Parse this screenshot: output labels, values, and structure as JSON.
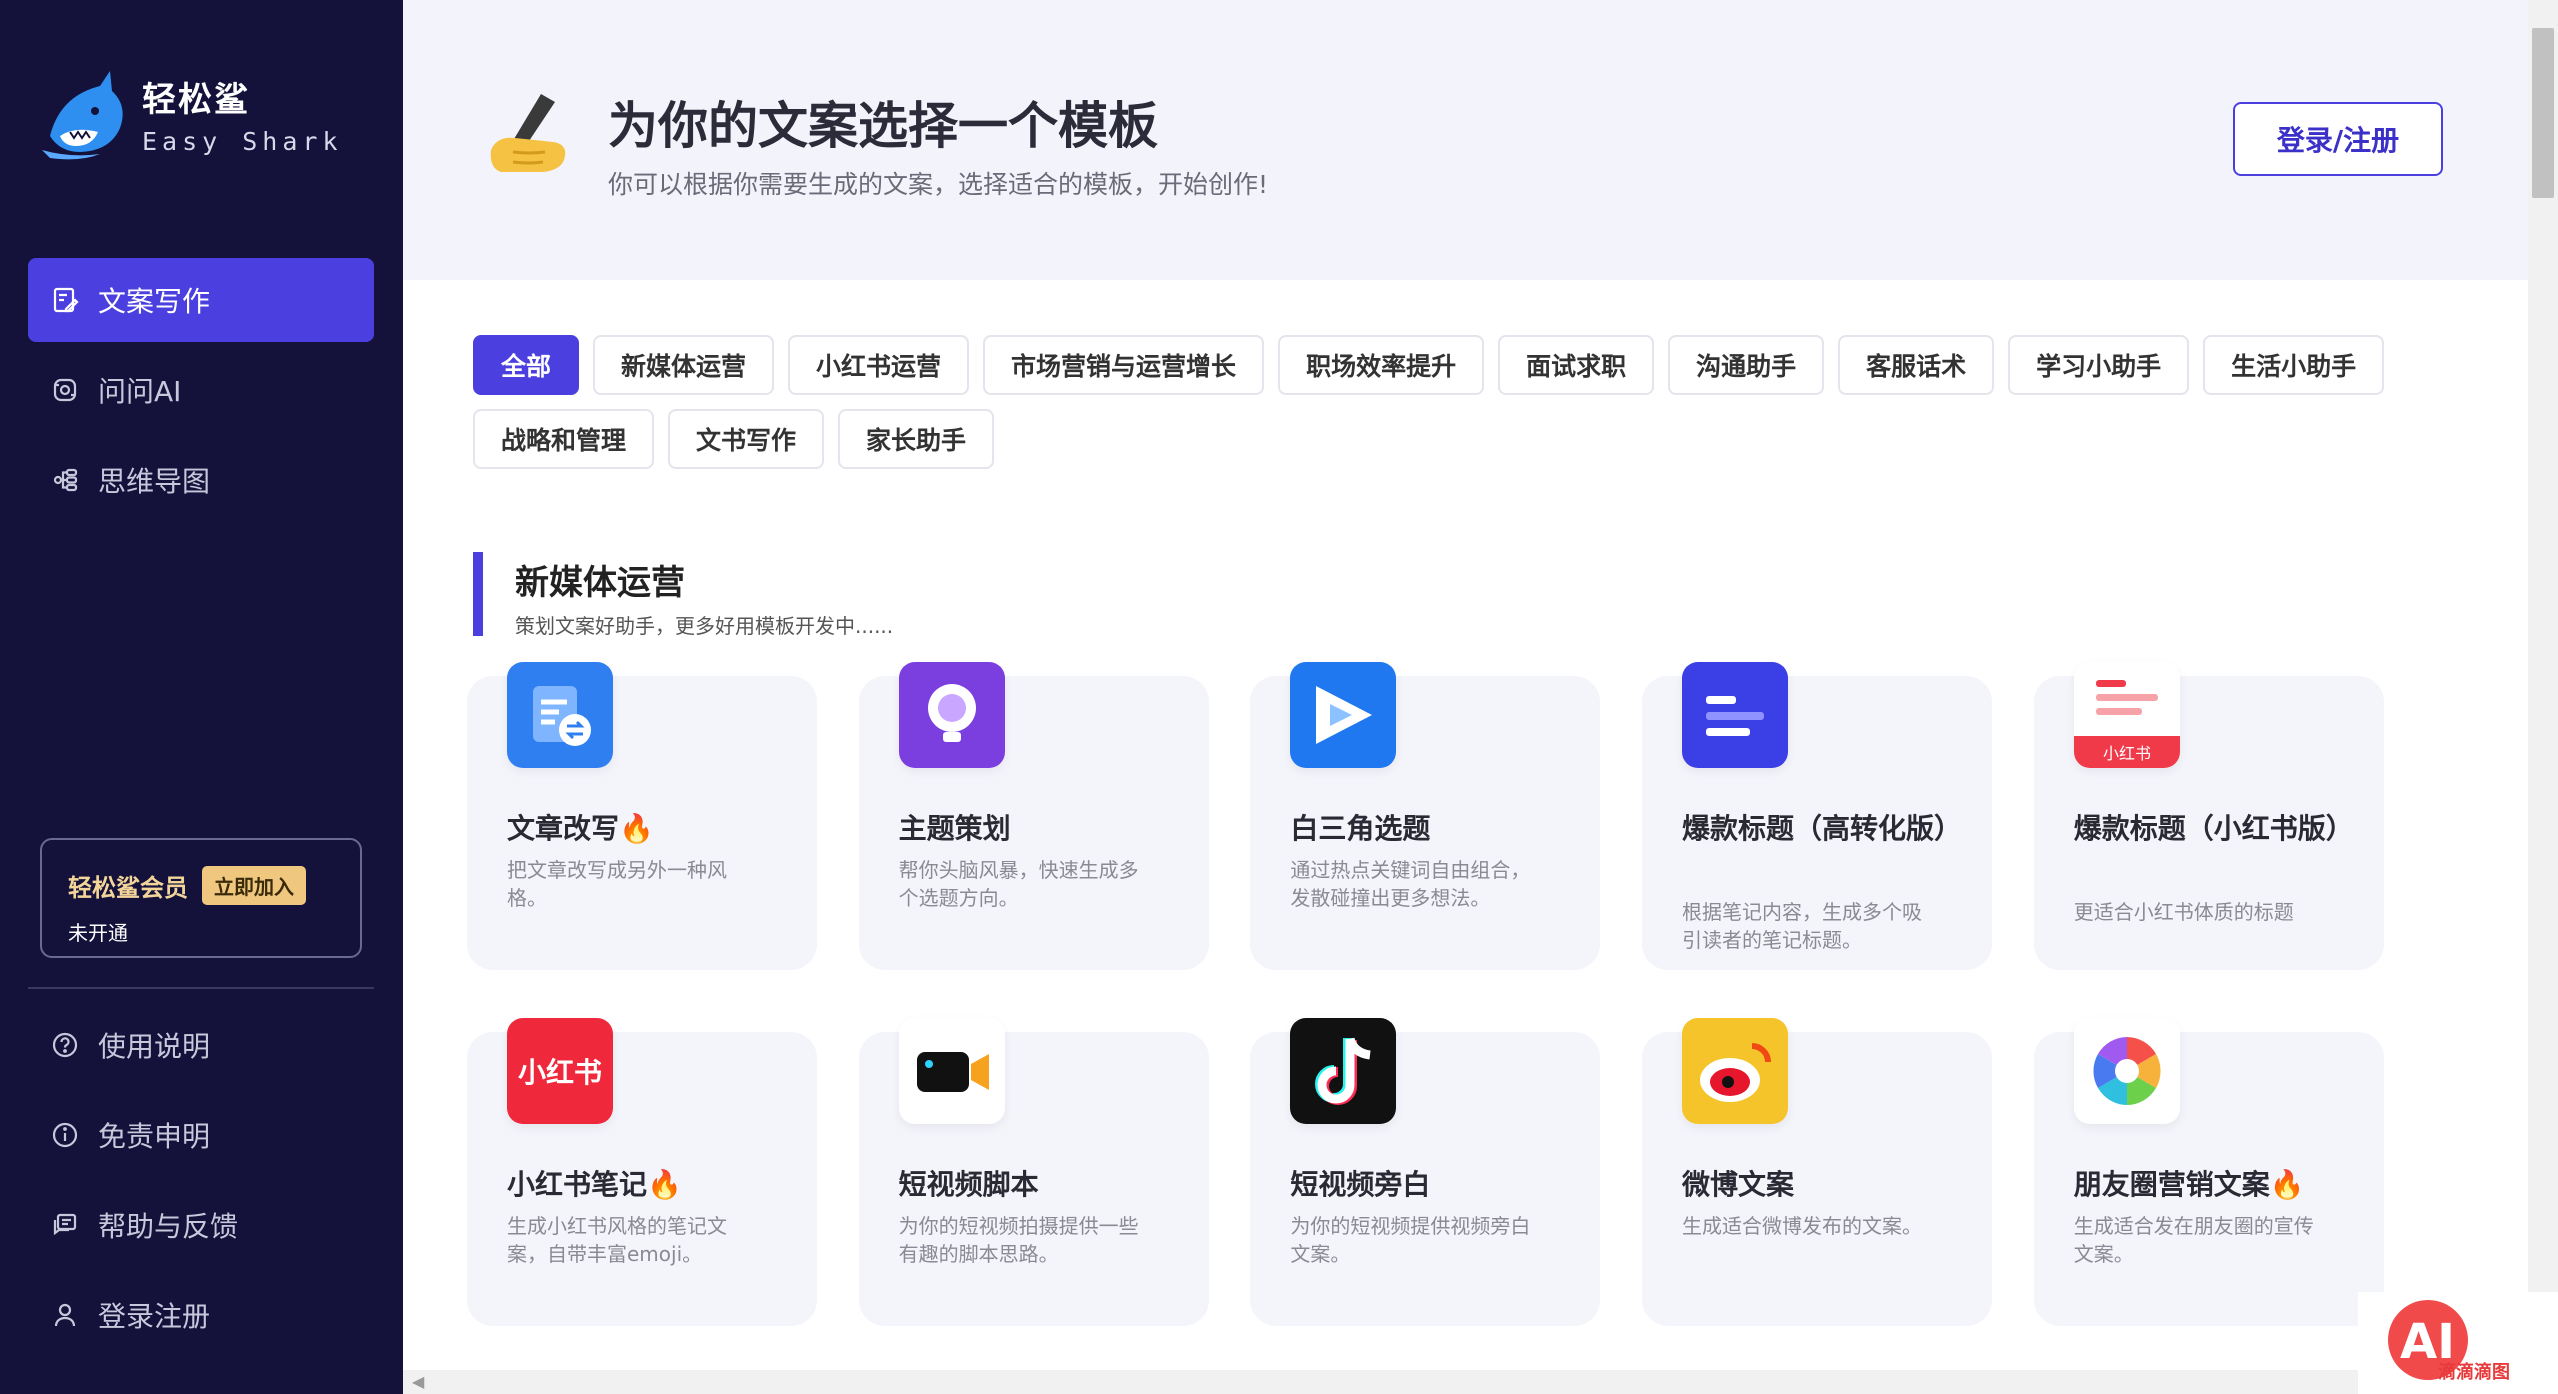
{
  "brand": {
    "name": "轻松鲨",
    "name_en": "Easy Shark"
  },
  "sidebar": {
    "nav": [
      {
        "label": "文案写作",
        "icon": "document-edit-icon",
        "active": true
      },
      {
        "label": "问问AI",
        "icon": "ai-chat-icon",
        "active": false
      },
      {
        "label": "思维导图",
        "icon": "mindmap-icon",
        "active": false
      }
    ],
    "member": {
      "title": "轻松鲨会员",
      "join": "立即加入",
      "status": "未开通"
    },
    "bottom": [
      {
        "label": "使用说明",
        "icon": "help-circle-icon"
      },
      {
        "label": "免责申明",
        "icon": "info-circle-icon"
      },
      {
        "label": "帮助与反馈",
        "icon": "feedback-icon"
      },
      {
        "label": "登录注册",
        "icon": "user-icon"
      }
    ]
  },
  "header": {
    "title": "为你的文案选择一个模板",
    "subtitle": "你可以根据你需要生成的文案，选择适合的模板，开始创作!",
    "login": "登录/注册",
    "icon": "writing-hand-icon"
  },
  "tabs": [
    "全部",
    "新媒体运营",
    "小红书运营",
    "市场营销与运营增长",
    "职场效率提升",
    "面试求职",
    "沟通助手",
    "客服话术",
    "学习小助手",
    "生活小助手",
    "战略和管理",
    "文书写作",
    "家长助手"
  ],
  "active_tab": "全部",
  "section": {
    "title": "新媒体运营",
    "desc": "策划文案好助手，更多好用模板开发中......"
  },
  "cards": [
    {
      "title": "文章改写",
      "fire": true,
      "desc": "把文章改写成另外一种风格。",
      "icon": "article-rewrite-icon",
      "color": "#2f7ff0"
    },
    {
      "title": "主题策划",
      "fire": false,
      "desc": "帮你头脑风暴，快速生成多个选题方向。",
      "icon": "lightbulb-icon",
      "color": "#7b3fe0"
    },
    {
      "title": "白三角选题",
      "fire": false,
      "desc": "通过热点关键词自由组合，发散碰撞出更多想法。",
      "icon": "triangle-play-icon",
      "color": "#1f78f0"
    },
    {
      "title": "爆款标题（高转化版）",
      "fire": false,
      "desc": "根据笔记内容，生成多个吸引读者的笔记标题。",
      "icon": "title-lines-icon",
      "color": "#3b3fe6"
    },
    {
      "title": "爆款标题（小红书版）",
      "fire": false,
      "desc": "更适合小红书体质的标题",
      "icon": "xiaohongshu-doc-icon",
      "color": "#f03a4a",
      "badge": "小红书"
    },
    {
      "title": "小红书笔记",
      "fire": true,
      "desc": "生成小红书风格的笔记文案，自带丰富emoji。",
      "icon": "xiaohongshu-icon",
      "color": "#f0283c",
      "badge": "小红书"
    },
    {
      "title": "短视频脚本",
      "fire": false,
      "desc": "为你的短视频拍摄提供一些有趣的脚本思路。",
      "icon": "video-camera-icon",
      "color": "#ffffff"
    },
    {
      "title": "短视频旁白",
      "fire": false,
      "desc": "为你的短视频提供视频旁白文案。",
      "icon": "tiktok-icon",
      "color": "#111111"
    },
    {
      "title": "微博文案",
      "fire": false,
      "desc": "生成适合微博发布的文案。",
      "icon": "weibo-icon",
      "color": "#f5c42a"
    },
    {
      "title": "朋友圈营销文案",
      "fire": true,
      "desc": "生成适合发在朋友圈的宣传文案。",
      "icon": "moments-aperture-icon",
      "color": "#ffffff"
    }
  ],
  "fire_emoji": "🔥",
  "watermark": "滴滴滴图"
}
